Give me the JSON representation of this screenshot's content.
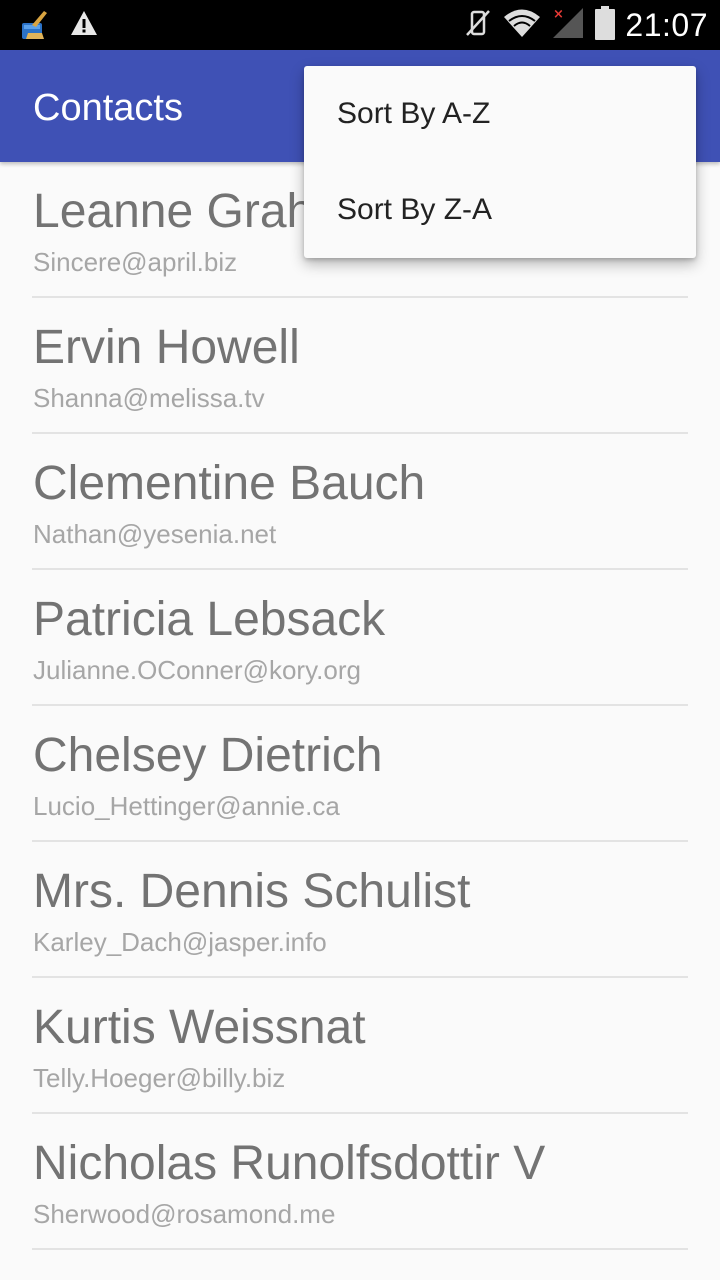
{
  "status_bar": {
    "time": "21:07",
    "left_icons": [
      "cleaner-broom-icon",
      "warning-icon"
    ],
    "right_icons": [
      "vibrate-mute-icon",
      "wifi-icon",
      "cell-signal-no-service-icon",
      "battery-icon"
    ]
  },
  "app_bar": {
    "title": "Contacts",
    "color": "#3f51b5"
  },
  "menu": {
    "items": [
      {
        "label": "Sort By A-Z"
      },
      {
        "label": "Sort By Z-A"
      }
    ]
  },
  "contacts": [
    {
      "name": "Leanne Graham",
      "email": "Sincere@april.biz"
    },
    {
      "name": "Ervin Howell",
      "email": "Shanna@melissa.tv"
    },
    {
      "name": "Clementine Bauch",
      "email": "Nathan@yesenia.net"
    },
    {
      "name": "Patricia Lebsack",
      "email": "Julianne.OConner@kory.org"
    },
    {
      "name": "Chelsey Dietrich",
      "email": "Lucio_Hettinger@annie.ca"
    },
    {
      "name": "Mrs. Dennis Schulist",
      "email": "Karley_Dach@jasper.info"
    },
    {
      "name": "Kurtis Weissnat",
      "email": "Telly.Hoeger@billy.biz"
    },
    {
      "name": "Nicholas Runolfsdottir V",
      "email": "Sherwood@rosamond.me"
    }
  ]
}
